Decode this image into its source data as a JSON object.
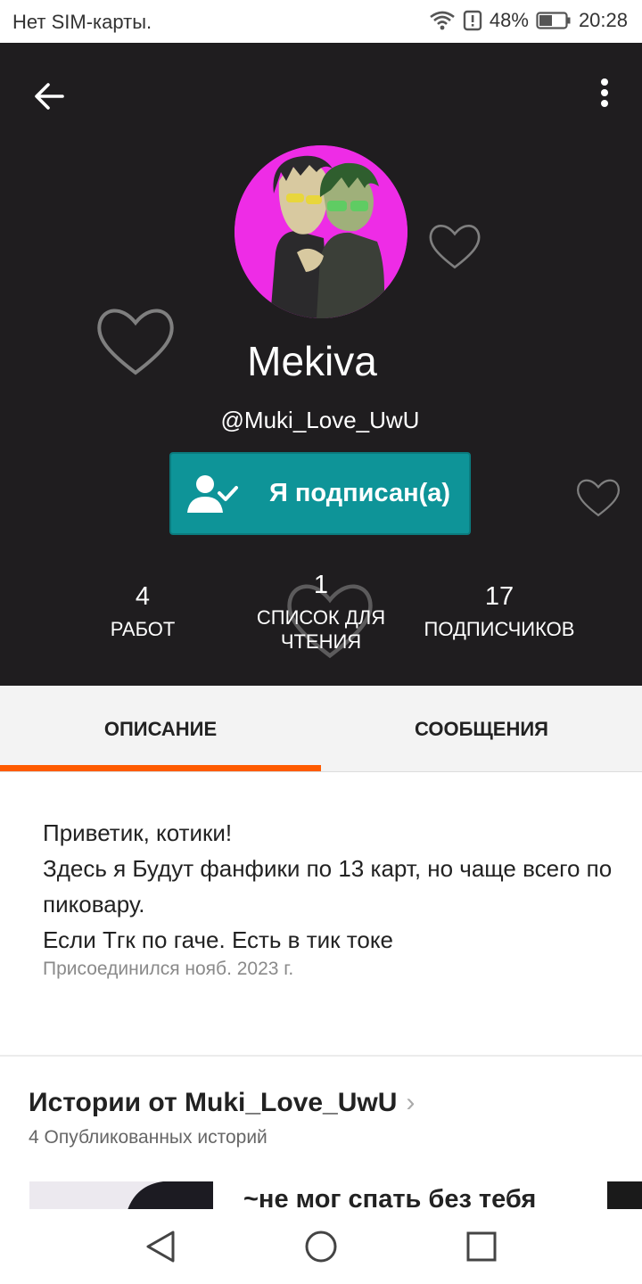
{
  "status_bar": {
    "carrier": "Нет SIM-карты.",
    "battery": "48%",
    "time": "20:28"
  },
  "profile": {
    "display_name": "Mekiva",
    "username": "@Muki_Love_UwU",
    "follow_button": "Я подписан(а)",
    "stats": [
      {
        "number": "4",
        "label": "РАБОТ"
      },
      {
        "number": "1",
        "label": "СПИСОК ДЛЯ ЧТЕНИЯ"
      },
      {
        "number": "17",
        "label": "ПОДПИСЧИКОВ"
      }
    ]
  },
  "tabs": [
    {
      "label": "ОПИСАНИЕ",
      "active": true
    },
    {
      "label": "СООБЩЕНИЯ",
      "active": false
    }
  ],
  "about": {
    "lines": [
      "Приветик, котики!",
      "Здесь я Будут фанфики по 13 карт, но чаще всего по пиковару.",
      "Если Тгк по гаче. Есть в тик токе"
    ],
    "joined": "Присоединился нояб. 2023 г."
  },
  "stories": {
    "title": "Истории от Muki_Love_UwU",
    "subtitle": "4 Опубликованных историй",
    "first_title": "~не мог спать без тебя"
  },
  "colors": {
    "header_bg": "#1f1d1f",
    "follow_button": "#0e9498",
    "tab_indicator": "#ff5b00",
    "avatar_bg": "#ee2ce6"
  }
}
